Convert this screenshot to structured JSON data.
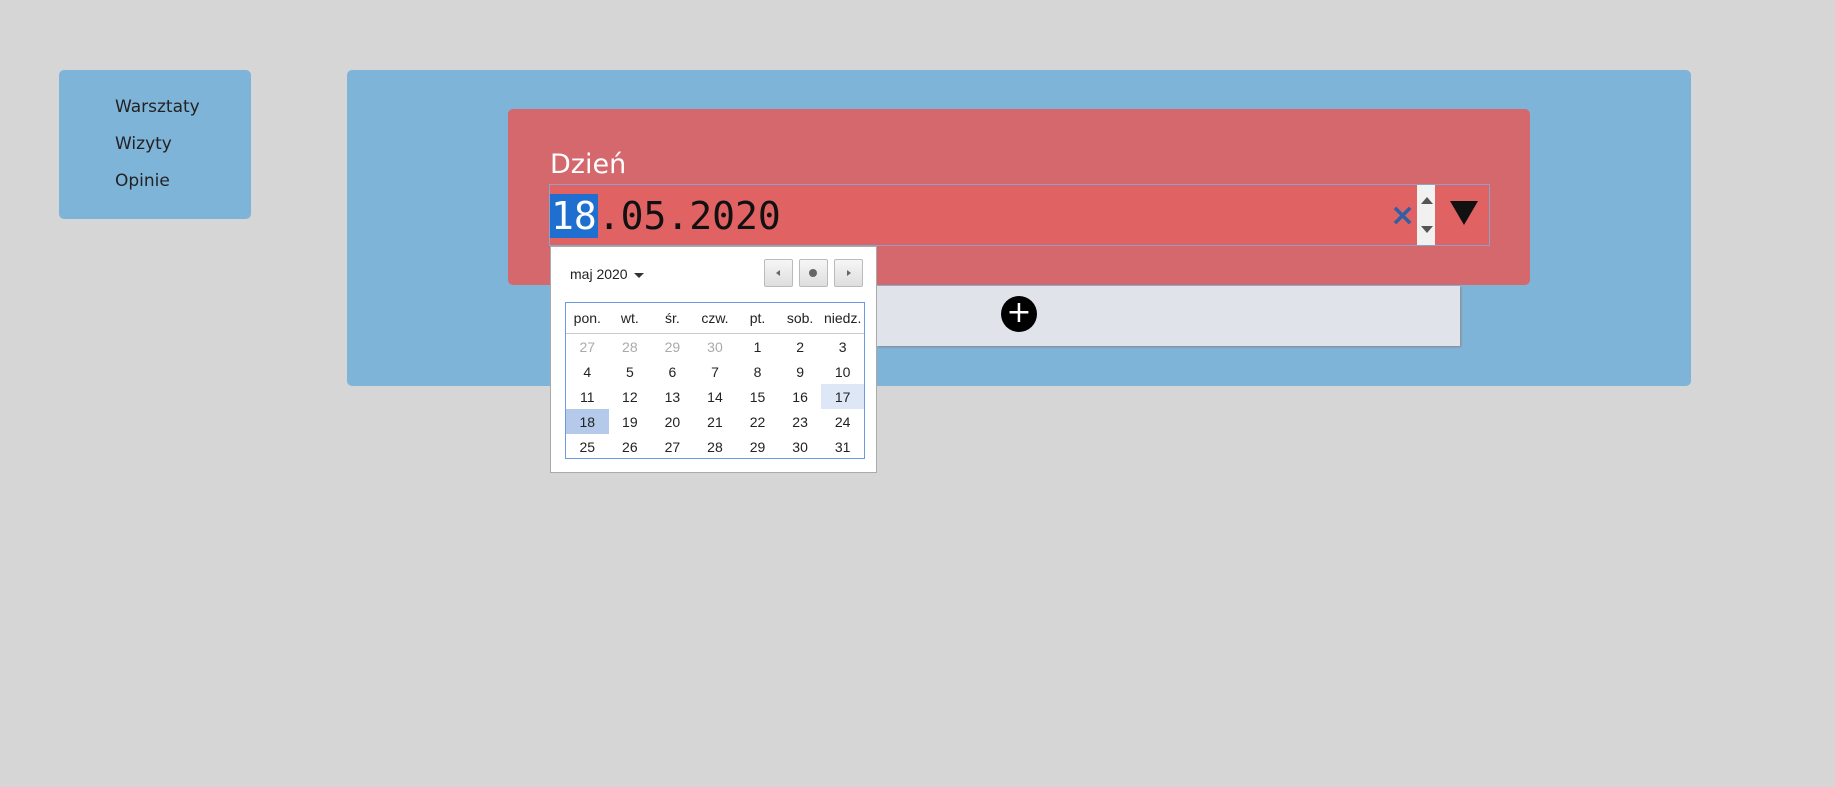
{
  "sidebar": {
    "items": [
      {
        "label": "Warsztaty"
      },
      {
        "label": "Wizyty"
      },
      {
        "label": "Opinie"
      }
    ]
  },
  "form": {
    "day_label": "Dzień",
    "date_selected_part": "18",
    "date_rest": ".05.2020",
    "clear_icon": "×",
    "add_icon": "+"
  },
  "calendar": {
    "month_label": "maj 2020",
    "weekdays": [
      "pon.",
      "wt.",
      "śr.",
      "czw.",
      "pt.",
      "sob.",
      "niedz."
    ],
    "weeks": [
      [
        "27",
        "28",
        "29",
        "30",
        "1",
        "2",
        "3"
      ],
      [
        "4",
        "5",
        "6",
        "7",
        "8",
        "9",
        "10"
      ],
      [
        "11",
        "12",
        "13",
        "14",
        "15",
        "16",
        "17"
      ],
      [
        "18",
        "19",
        "20",
        "21",
        "22",
        "23",
        "24"
      ],
      [
        "25",
        "26",
        "27",
        "28",
        "29",
        "30",
        "31"
      ]
    ],
    "other_month_days": [
      "0-0",
      "0-1",
      "0-2",
      "0-3"
    ],
    "today_cell": "2-6",
    "selected_cell": "3-0"
  },
  "colors": {
    "background": "#d6d6d6",
    "panel": "#7fb4d9",
    "card": "#d4686d",
    "input": "#e06262",
    "selection": "#1e6fd0"
  },
  "icons": {
    "clear": "close-icon",
    "dropdown": "triangle-down-icon",
    "add": "plus-circle-icon",
    "prev": "chevron-left-icon",
    "next": "chevron-right-icon",
    "today": "dot-icon"
  }
}
